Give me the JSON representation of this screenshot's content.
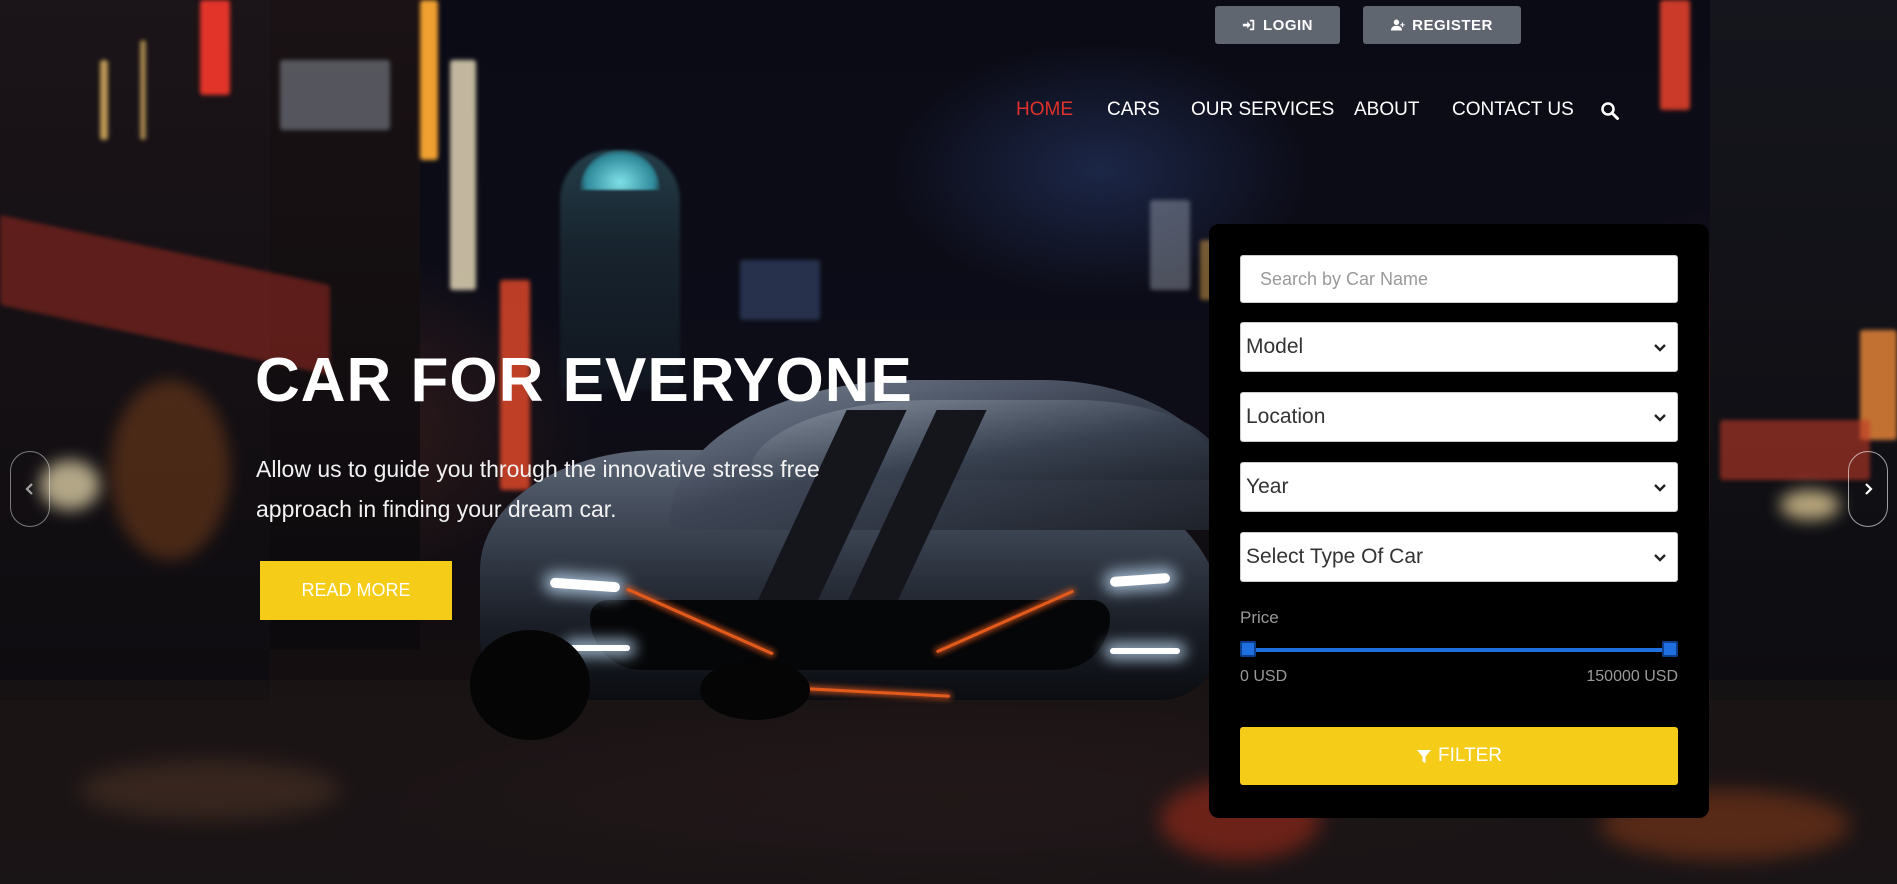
{
  "header": {
    "login_label": "LOGIN",
    "register_label": "REGISTER"
  },
  "nav": {
    "items": [
      {
        "label": "HOME",
        "active": true
      },
      {
        "label": "CARS",
        "active": false
      },
      {
        "label": "OUR SERVICES",
        "active": false
      },
      {
        "label": "ABOUT",
        "active": false
      },
      {
        "label": "CONTACT US",
        "active": false
      }
    ],
    "search_icon": "search-icon"
  },
  "hero": {
    "title": "CAR FOR EVERYONE",
    "description": "Allow us to guide you through the innovative stress free approach in finding your dream car.",
    "read_more_label": "READ MORE"
  },
  "filter": {
    "search_placeholder": "Search by Car Name",
    "model_selected": "Model",
    "location_selected": "Location",
    "year_selected": "Year",
    "type_selected": "Select Type Of Car",
    "price_label": "Price",
    "price_min": "0 USD",
    "price_max": "150000 USD",
    "price_range_selected": [
      0,
      150000
    ],
    "filter_label": "FILTER"
  },
  "colors": {
    "accent_yellow": "#f5cc18",
    "nav_active": "#e0312a",
    "auth_button_bg": "#5f6670",
    "slider_blue": "#1f6fe0"
  }
}
